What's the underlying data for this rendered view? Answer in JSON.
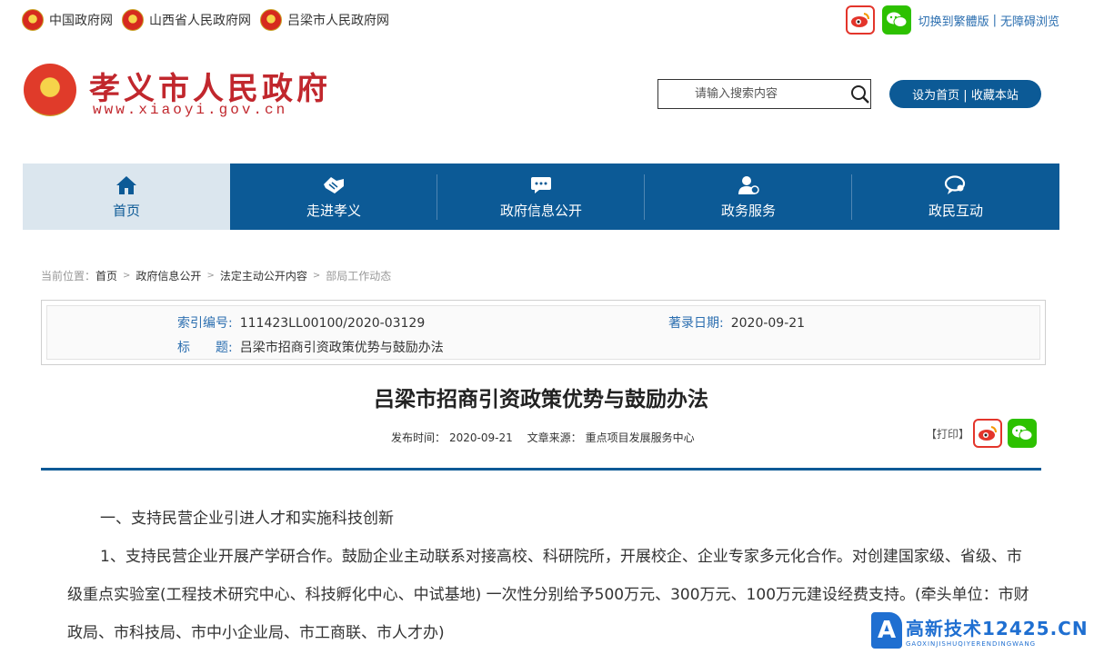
{
  "topbar": {
    "links": [
      "中国政府网",
      "山西省人民政府网",
      "吕梁市人民政府网"
    ],
    "switch_traditional": "切换到繁體版",
    "separator": "|",
    "accessibility": "无障碍浏览"
  },
  "header": {
    "site_title": "孝义市人民政府",
    "site_url": "www.xiaoyi.gov.cn",
    "search_placeholder": "请输入搜索内容",
    "home_button": "设为首页 | 收藏本站"
  },
  "nav": {
    "items": [
      {
        "label": "首页",
        "icon": "home-icon"
      },
      {
        "label": "走进孝义",
        "icon": "handshake-icon"
      },
      {
        "label": "政府信息公开",
        "icon": "chat-bubble-icon"
      },
      {
        "label": "政务服务",
        "icon": "user-service-icon"
      },
      {
        "label": "政民互动",
        "icon": "dialog-icon"
      }
    ]
  },
  "breadcrumb": {
    "prefix": "当前位置：",
    "items": [
      "首页",
      "政府信息公开",
      "法定主动公开内容",
      "部局工作动态"
    ],
    "arrow": ">"
  },
  "info": {
    "index_label": "索引编号:",
    "index_value": "111423LL00100/2020-03129",
    "date_label": "著录日期:",
    "date_value": "2020-09-21",
    "title_label": "标　　题:",
    "title_value": "吕梁市招商引资政策优势与鼓励办法"
  },
  "article": {
    "title": "吕梁市招商引资政策优势与鼓励办法",
    "publish_label": "发布时间：",
    "publish_date": "2020-09-21",
    "source_label": "文章来源：",
    "source_value": "重点项目发展服务中心",
    "print_label": "【打印】",
    "paragraphs": [
      "一、支持民营企业引进人才和实施科技创新",
      "1、支持民营企业开展产学研合作。鼓励企业主动联系对接高校、科研院所，开展校企、企业专家多元化合作。对创建国家级、省级、市级重点实验室(工程技术研究中心、科技孵化中心、中试基地) 一次性分别给予500万元、300万元、100万元建设经费支持。(牵头单位：市财政局、市科技局、市中小企业局、市工商联、市人才办)"
    ]
  },
  "watermark": {
    "logo": "A",
    "main": "高新技术12425.CN",
    "sub": "GAOXINJISHUQIYERENDINGWANG"
  },
  "colors": {
    "primary": "#0c5a96",
    "brand_red": "#c1272d",
    "link_blue": "#2c6fb0"
  }
}
